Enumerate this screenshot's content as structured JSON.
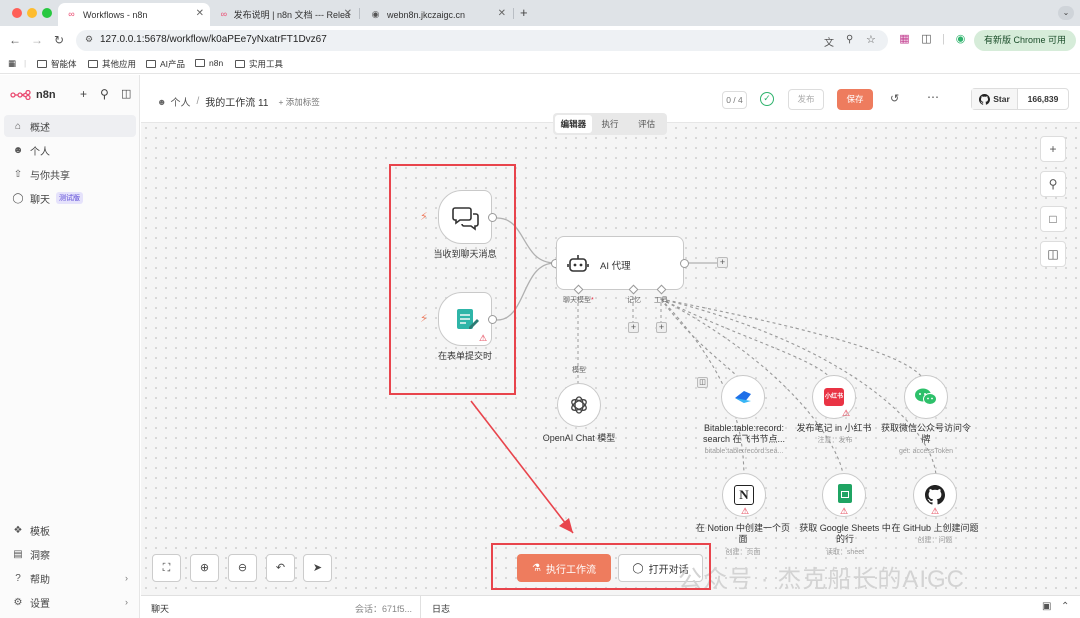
{
  "browser": {
    "tabs": [
      {
        "title": "Workflows - n8n",
        "active": true
      },
      {
        "title": "发布说明 | n8n 文档 --- Relea",
        "active": false
      },
      {
        "title": "webn8n.jkczaigc.cn",
        "active": false
      }
    ],
    "new_tab": "+",
    "url": "127.0.0.1:5678/workflow/k0aPEe7yNxatrFT1Dvz67",
    "update_label": "有新版 Chrome 可用",
    "bookmarks": [
      "智能体",
      "其他应用",
      "AI产品",
      "n8n",
      "实用工具"
    ]
  },
  "sidebar": {
    "brand": "n8n",
    "items": [
      {
        "label": "概述",
        "icon": "home-icon",
        "active": true
      },
      {
        "label": "个人",
        "icon": "user-icon",
        "active": false
      },
      {
        "label": "与你共享",
        "icon": "share-icon",
        "active": false
      },
      {
        "label": "聊天",
        "icon": "chat-icon",
        "active": false,
        "badge": "测试版"
      }
    ],
    "bottom_items": [
      {
        "label": "模板",
        "icon": "template-icon"
      },
      {
        "label": "洞察",
        "icon": "insights-icon"
      },
      {
        "label": "帮助",
        "icon": "help-icon"
      },
      {
        "label": "设置",
        "icon": "settings-icon"
      }
    ]
  },
  "header": {
    "owner": "个人",
    "workflow_name": "我的工作流 11",
    "add_tag": "+ 添加标签",
    "counter": "0 / 4",
    "publish": "发布",
    "save": "保存",
    "github_star": "Star",
    "github_count": "166,839"
  },
  "view_tabs": [
    "编辑器",
    "执行",
    "评估"
  ],
  "nodes": {
    "chat_trigger": {
      "label": "当收到聊天消息"
    },
    "form_trigger": {
      "label": "在表单提交时"
    },
    "agent": {
      "label": "AI 代理",
      "h_model": "聊天模型",
      "h_model_req": "*",
      "h_memory": "记忆",
      "h_tool": "工具"
    },
    "openai": {
      "label": "OpenAI Chat 模型",
      "edge_label": "模型"
    },
    "bitable": {
      "label": "Bitable:table:record: search 在飞书节点...",
      "sub": "bitable:table:record:sea..."
    },
    "xhs": {
      "label": "发布笔记 in 小红书",
      "sub": "注意：发布"
    },
    "wechat": {
      "label": "获取微信公众号访问令牌",
      "sub": "get: accessToken"
    },
    "notion": {
      "label": "在 Notion 中创建一个页面",
      "sub": "创建：页面"
    },
    "sheets": {
      "label": "获取 Google Sheets 中的行",
      "sub": "读取：sheet"
    },
    "github": {
      "label": "在 GitHub 上创建问题",
      "sub": "创建：问题"
    }
  },
  "actions": {
    "execute": "执行工作流",
    "open_chat": "打开对话"
  },
  "watermark": "公众号 · 杰克船长的AIGC",
  "bottombar": {
    "chat": "聊天",
    "session": "会话：671f5...",
    "logs": "日志"
  },
  "colors": {
    "accent": "#ee7c5e",
    "annotation_red": "#e8444c",
    "success": "#2fb36d"
  }
}
